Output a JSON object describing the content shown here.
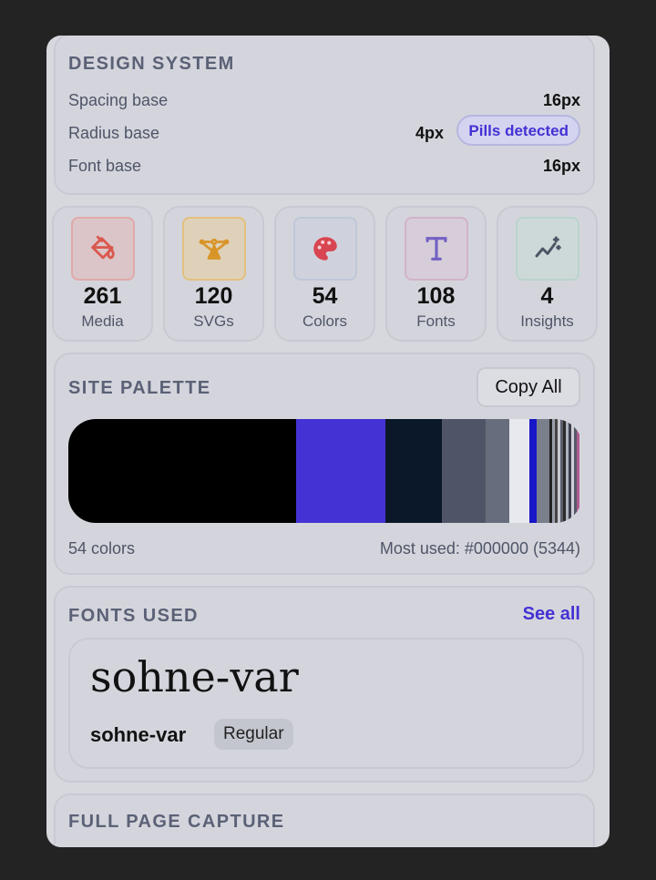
{
  "design_system": {
    "title": "DESIGN SYSTEM",
    "rows": [
      {
        "label": "Spacing base",
        "value": "16px"
      },
      {
        "label": "Radius base",
        "value": "4px",
        "badge": "Pills detected"
      },
      {
        "label": "Font base",
        "value": "16px"
      }
    ]
  },
  "stats": [
    {
      "value": "261",
      "label": "Media",
      "icon": "paint-bucket-icon",
      "color": "#d9594f"
    },
    {
      "value": "120",
      "label": "SVGs",
      "icon": "vector-pen-icon",
      "color": "#d99428"
    },
    {
      "value": "54",
      "label": "Colors",
      "icon": "palette-icon",
      "color": "#d84550"
    },
    {
      "value": "108",
      "label": "Fonts",
      "icon": "type-icon",
      "color": "#7360c4"
    },
    {
      "value": "4",
      "label": "Insights",
      "icon": "sparkle-trend-icon",
      "color": "#4b5566"
    }
  ],
  "palette": {
    "title": "SITE PALETTE",
    "copy_label": "Copy All",
    "count_label": "54 colors",
    "most_used_label": "Most used: #000000 (5344)",
    "swatches": [
      "#000000",
      "#4433d4",
      "#0b1829",
      "#4f5566",
      "#676d7c",
      "#e8e9ee",
      "#1816c8",
      "#7a7f8c"
    ]
  },
  "fonts": {
    "title": "FONTS USED",
    "see_all": "See all",
    "preview": "sohne-var",
    "name": "sohne-var",
    "weight": "Regular"
  },
  "capture": {
    "title": "FULL PAGE CAPTURE"
  },
  "colors": {
    "accent": "#4431d4",
    "background": "#232323"
  }
}
